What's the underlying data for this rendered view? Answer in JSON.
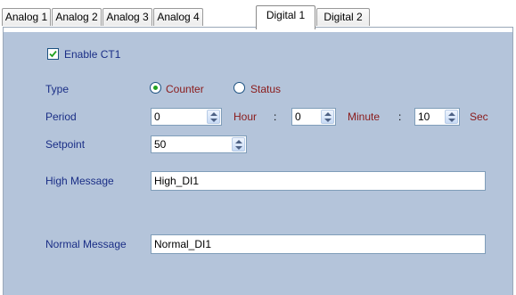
{
  "tabs": [
    {
      "label": "Analog 1"
    },
    {
      "label": "Analog 2"
    },
    {
      "label": "Analog 3"
    },
    {
      "label": "Analog 4"
    },
    {
      "label": "Digital 1"
    },
    {
      "label": "Digital 2"
    }
  ],
  "active_tab": "Digital 1",
  "enable": {
    "label": "Enable CT1",
    "checked": true
  },
  "type": {
    "label": "Type",
    "options": [
      "Counter",
      "Status"
    ],
    "selected": "Counter"
  },
  "period": {
    "label": "Period",
    "hour_value": "0",
    "hour_unit": "Hour",
    "minute_value": "0",
    "minute_unit": "Minute",
    "sec_value": "10",
    "sec_unit": "Sec",
    "separator": ":"
  },
  "setpoint": {
    "label": "Setpoint",
    "value": "50"
  },
  "high_message": {
    "label": "High Message",
    "value": "High_DI1"
  },
  "normal_message": {
    "label": "Normal Message",
    "value": "Normal_DI1"
  },
  "colors": {
    "label_blue": "#1a2e86",
    "unit_red": "#8a1a1a",
    "panel_bg": "#b4c4da",
    "radio_green": "#21a121"
  }
}
